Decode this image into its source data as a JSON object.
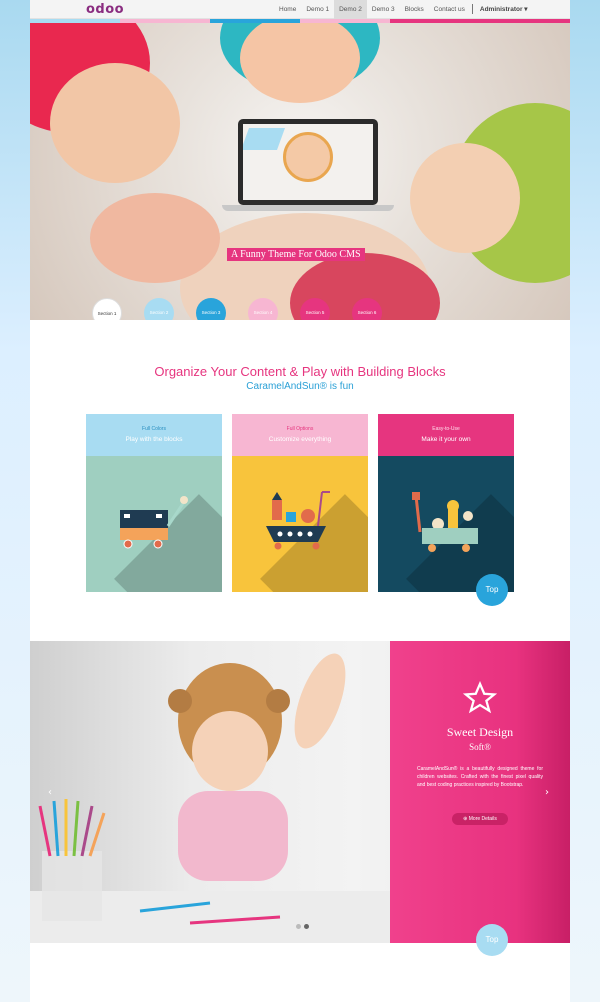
{
  "colors": {
    "pink": "#e6357f",
    "blue": "#29a4db",
    "light_blue": "#a8dcf2",
    "yellow": "#f8c43c",
    "dark_teal": "#144a60",
    "mint": "#9fcfc0"
  },
  "navbar": {
    "logo": "odoo",
    "items": [
      {
        "label": "Home",
        "active": false
      },
      {
        "label": "Demo 1",
        "active": false
      },
      {
        "label": "Demo 2",
        "active": true
      },
      {
        "label": "Demo 3",
        "active": false
      },
      {
        "label": "Blocks",
        "active": false
      },
      {
        "label": "Contact us",
        "active": false
      }
    ],
    "user": "Administrator ▾"
  },
  "hero": {
    "caption": "A Funny Theme For Odoo CMS",
    "sections": [
      "Section 1",
      "Section 2",
      "Section 3",
      "Section 4",
      "Section 5",
      "Section 6"
    ]
  },
  "intro": {
    "title": "Organize Your Content & Play with Building Blocks",
    "subtitle": "CaramelAndSun® is fun"
  },
  "cards": [
    {
      "tag": "Full Colors",
      "title": "Play with the blocks",
      "icon": "wagon-icon"
    },
    {
      "tag": "Full Options",
      "title": "Customize everything",
      "icon": "toy-boat-icon"
    },
    {
      "tag": "Easy-to-Use",
      "title": "Make it your own",
      "icon": "toy-cart-icon"
    }
  ],
  "top_label": "Top",
  "slider": {
    "title": "Sweet Design",
    "subtitle": "Soft®",
    "body": "CaramelAndSun® is a beautifully designed theme for children websites. Crafted with the finest pixel quality and best coding practices inspired by Bootstrap.",
    "button": "More Details",
    "prev": "‹",
    "next": "›"
  }
}
